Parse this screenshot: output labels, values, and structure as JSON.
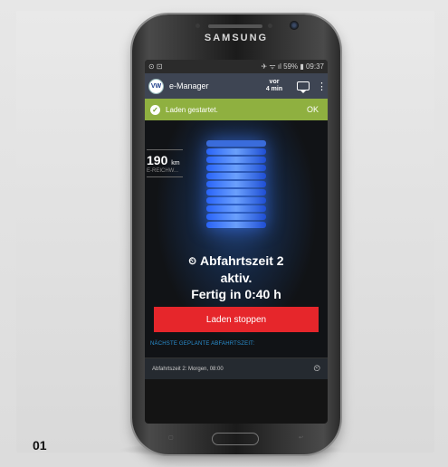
{
  "figure_number": "01",
  "phone_brand": "SAMSUNG",
  "status_bar": {
    "left_icons": "⊙ ⊡",
    "right_text": "✈ ᯤ ıl 59% ▮ 09:37"
  },
  "app_bar": {
    "title": "e-Manager",
    "update_line1": "vor",
    "update_line2": "4 min",
    "logo_text": "VW",
    "icons": [
      "vw-logo-icon",
      "chat-icon",
      "menu-icon"
    ]
  },
  "notification": {
    "text": "Laden gestartet.",
    "ok_label": "OK"
  },
  "range": {
    "value": "190",
    "unit": "km",
    "label": "E-REICHW..."
  },
  "departure": {
    "line1": "Abfahrtszeit 2",
    "line2": "aktiv.",
    "line3": "Fertig in 0:40 h"
  },
  "stop_button_label": "Laden stoppen",
  "next_departure": {
    "heading": "NÄCHSTE GEPLANTE ABFAHRTSZEIT:",
    "item_text": "Abfahrtszeit 2: Morgen, 08:00"
  },
  "colors": {
    "notification_green": "#8fb040",
    "stop_red": "#e6262b",
    "accent_blue": "#2a8fd0",
    "glow_blue": "#3a7bff"
  }
}
